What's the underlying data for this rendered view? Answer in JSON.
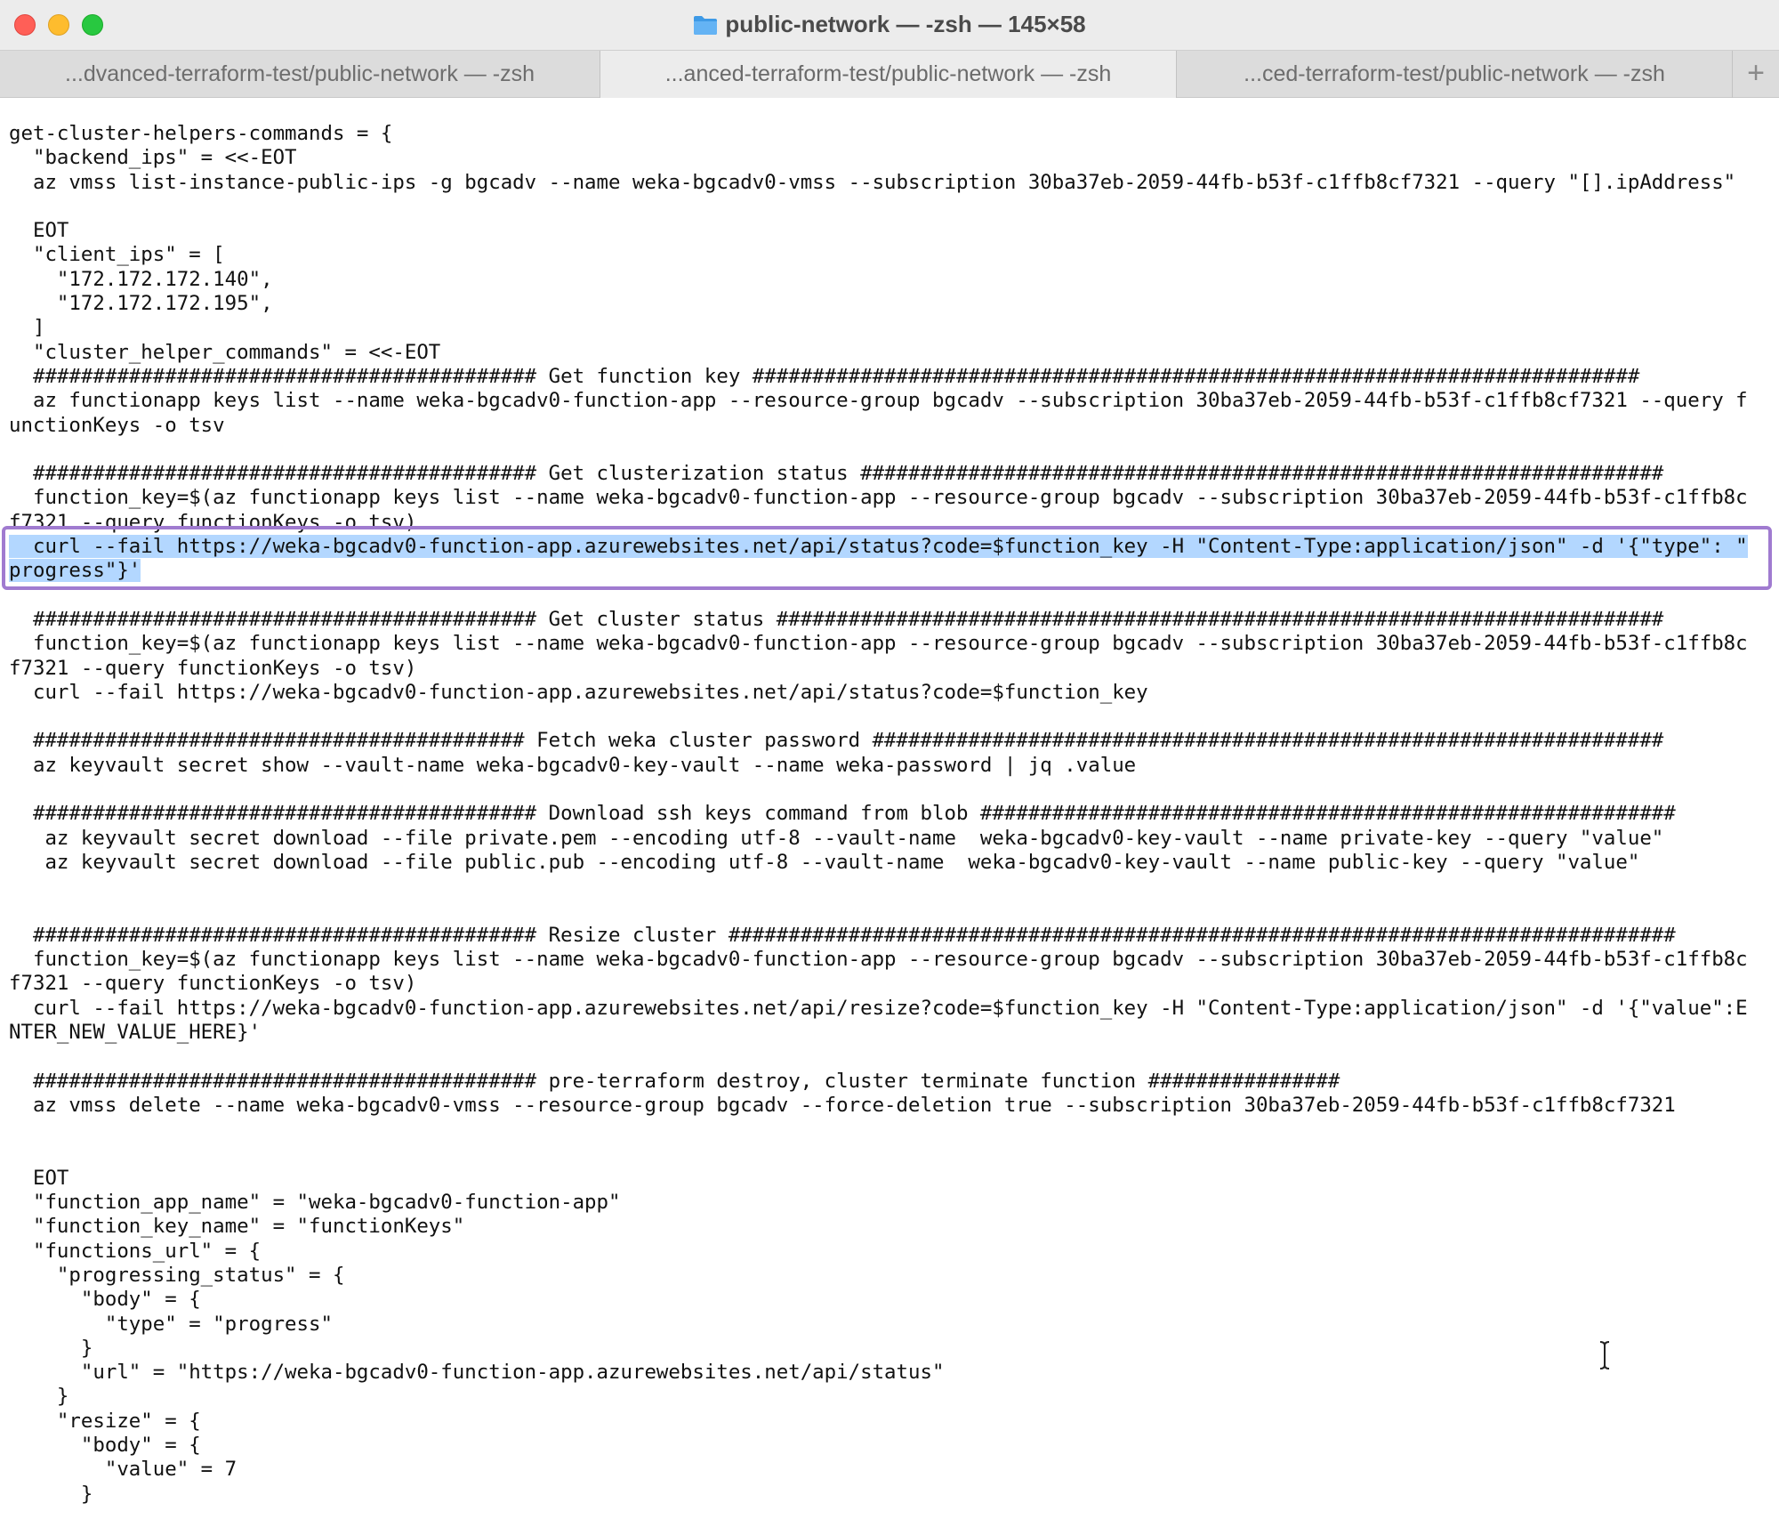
{
  "window": {
    "title": "public-network — -zsh — 145×58",
    "tabs": [
      {
        "label": "...dvanced-terraform-test/public-network — -zsh",
        "active": false
      },
      {
        "label": "...anced-terraform-test/public-network — -zsh",
        "active": true
      },
      {
        "label": "...ced-terraform-test/public-network — -zsh",
        "active": false
      }
    ],
    "new_tab_label": "+"
  },
  "terminal": {
    "lines": [
      "get-cluster-helpers-commands = {",
      "  \"backend_ips\" = <<-EOT",
      "  az vmss list-instance-public-ips -g bgcadv --name weka-bgcadv0-vmss --subscription 30ba37eb-2059-44fb-b53f-c1ffb8cf7321 --query \"[].ipAddress\"",
      "",
      "  EOT",
      "  \"client_ips\" = [",
      "    \"172.172.172.140\",",
      "    \"172.172.172.195\",",
      "  ]",
      "  \"cluster_helper_commands\" = <<-EOT",
      "  ########################################## Get function key ##########################################################################",
      "  az functionapp keys list --name weka-bgcadv0-function-app --resource-group bgcadv --subscription 30ba37eb-2059-44fb-b53f-c1ffb8cf7321 --query f",
      "unctionKeys -o tsv",
      "",
      "  ########################################## Get clusterization status ###################################################################",
      "  function_key=$(az functionapp keys list --name weka-bgcadv0-function-app --resource-group bgcadv --subscription 30ba37eb-2059-44fb-b53f-c1ffb8c",
      "f7321 --query functionKeys -o tsv)",
      "  curl --fail https://weka-bgcadv0-function-app.azurewebsites.net/api/status?code=$function_key -H \"Content-Type:application/json\" -d '{\"type\": \"",
      "progress\"}'",
      "",
      "  ########################################## Get cluster status ##########################################################################",
      "  function_key=$(az functionapp keys list --name weka-bgcadv0-function-app --resource-group bgcadv --subscription 30ba37eb-2059-44fb-b53f-c1ffb8c",
      "f7321 --query functionKeys -o tsv)",
      "  curl --fail https://weka-bgcadv0-function-app.azurewebsites.net/api/status?code=$function_key",
      "",
      "  ######################################### Fetch weka cluster password ##################################################################",
      "  az keyvault secret show --vault-name weka-bgcadv0-key-vault --name weka-password | jq .value",
      "",
      "  ########################################## Download ssh keys command from blob ##########################################################",
      "   az keyvault secret download --file private.pem --encoding utf-8 --vault-name  weka-bgcadv0-key-vault --name private-key --query \"value\"",
      "   az keyvault secret download --file public.pub --encoding utf-8 --vault-name  weka-bgcadv0-key-vault --name public-key --query \"value\"",
      "",
      "",
      "  ########################################## Resize cluster ###############################################################################",
      "  function_key=$(az functionapp keys list --name weka-bgcadv0-function-app --resource-group bgcadv --subscription 30ba37eb-2059-44fb-b53f-c1ffb8c",
      "f7321 --query functionKeys -o tsv)",
      "  curl --fail https://weka-bgcadv0-function-app.azurewebsites.net/api/resize?code=$function_key -H \"Content-Type:application/json\" -d '{\"value\":E",
      "NTER_NEW_VALUE_HERE}'",
      "",
      "  ########################################## pre-terraform destroy, cluster terminate function ################",
      "  az vmss delete --name weka-bgcadv0-vmss --resource-group bgcadv --force-deletion true --subscription 30ba37eb-2059-44fb-b53f-c1ffb8cf7321",
      "",
      "",
      "  EOT",
      "  \"function_app_name\" = \"weka-bgcadv0-function-app\"",
      "  \"function_key_name\" = \"functionKeys\"",
      "  \"functions_url\" = {",
      "    \"progressing_status\" = {",
      "      \"body\" = {",
      "        \"type\" = \"progress\"",
      "      }",
      "      \"url\" = \"https://weka-bgcadv0-function-app.azurewebsites.net/api/status\"",
      "    }",
      "    \"resize\" = {",
      "      \"body\" = {",
      "        \"value\" = 7",
      "      }"
    ],
    "selected_lines": [
      17,
      18
    ]
  },
  "colors": {
    "selection": "#b3d7ff",
    "highlight_box": "#a07bd0"
  },
  "icons": [
    "folder-icon",
    "text-cursor-icon"
  ]
}
